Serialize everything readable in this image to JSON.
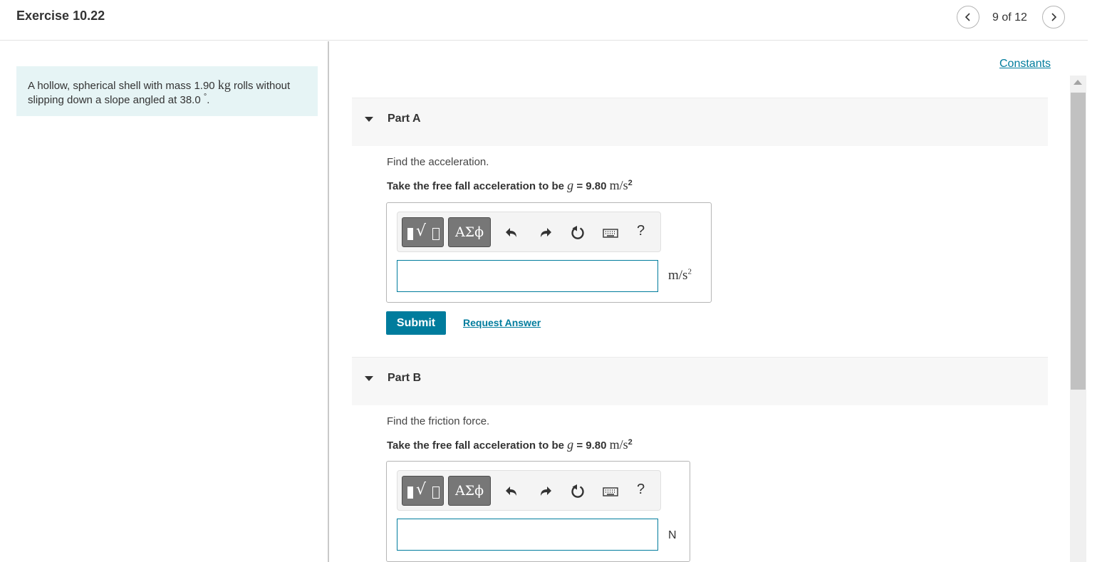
{
  "header": {
    "title": "Exercise 10.22",
    "page_count": "9 of 12"
  },
  "problem": {
    "text_before_unit": "A hollow, spherical shell with mass 1.90 ",
    "mass_unit": "kg",
    "text_after_unit": " rolls without slipping down a slope angled at 38.0 ",
    "degree_symbol": "°",
    "text_end": "."
  },
  "constants_link": "Constants",
  "instruction": {
    "prefix": "Take the free fall acceleration to be ",
    "var": "g",
    "equals": " = 9.80 ",
    "unit": "m/s",
    "exponent": "2"
  },
  "toolbar": {
    "greek_label": "ΑΣϕ",
    "help_label": "?"
  },
  "parts": [
    {
      "title": "Part A",
      "question": "Find the acceleration.",
      "unit": "m/s",
      "unit_exponent": "2"
    },
    {
      "title": "Part B",
      "question": "Find the friction force.",
      "unit": "N"
    }
  ],
  "actions": {
    "submit_label": "Submit",
    "request_label": "Request Answer"
  }
}
